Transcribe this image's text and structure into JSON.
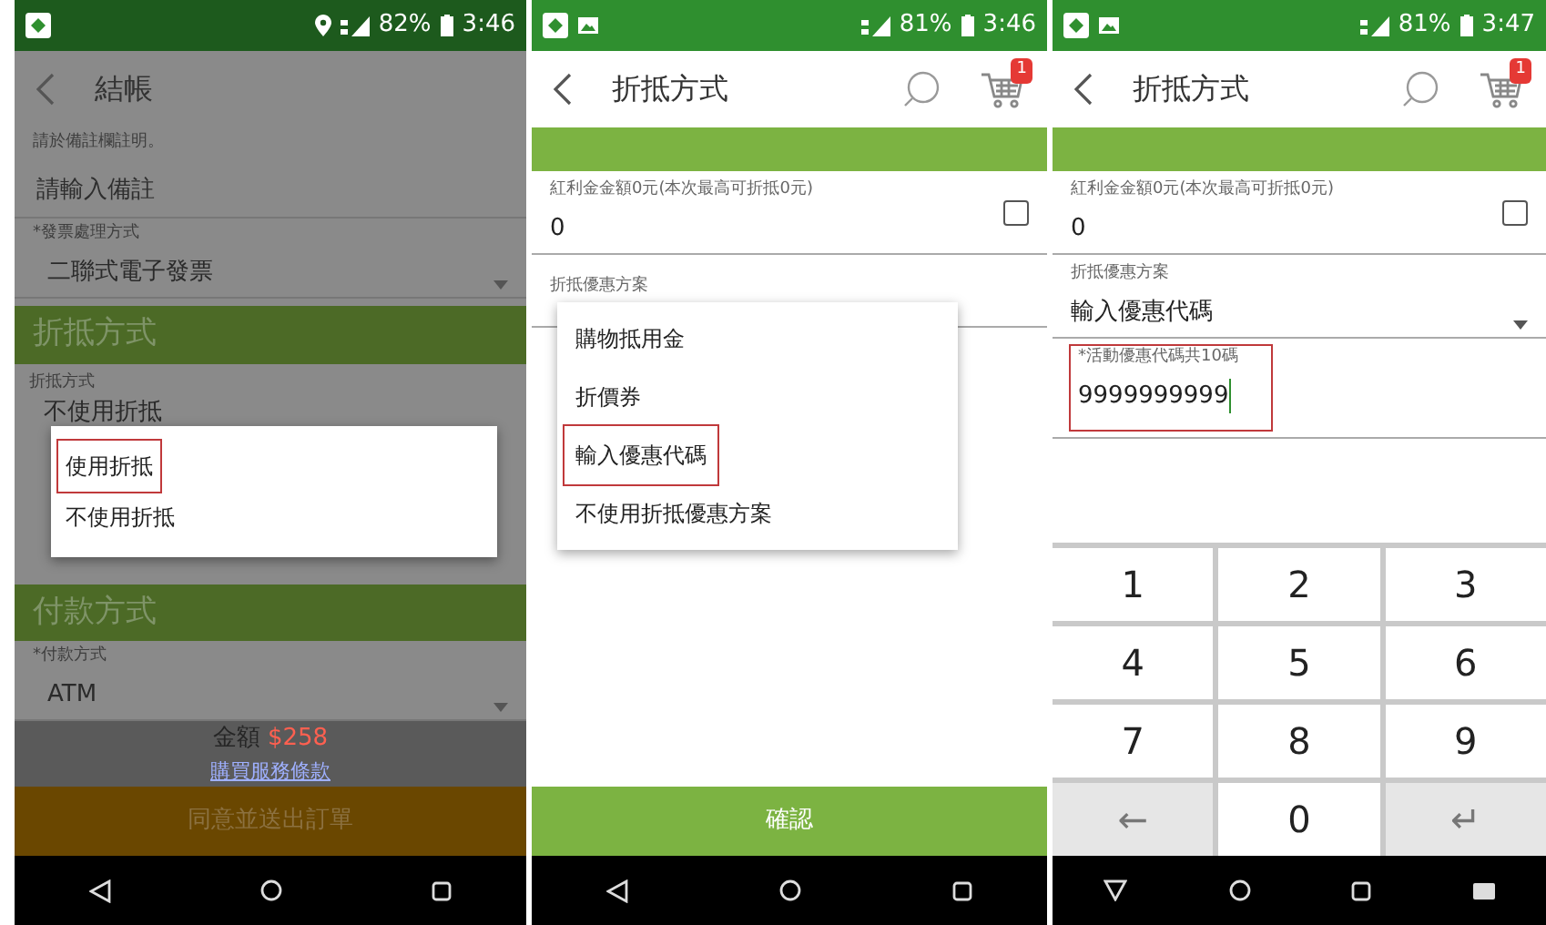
{
  "screens": [
    {
      "kind": "checkout",
      "status": {
        "location": true,
        "image_notice": false,
        "battery": "82%",
        "time": "3:46"
      },
      "title": "結帳",
      "remark_hint": "請於備註欄註明。",
      "remark": {
        "placeholder": "請輸入備註"
      },
      "invoice": {
        "label": "*發票處理方式",
        "value": "二聯式電子發票"
      },
      "discount_section": "折抵方式",
      "discount": {
        "label": "折抵方式",
        "value": "不使用折抵"
      },
      "dialog": [
        {
          "label": "使用折抵",
          "highlighted": true
        },
        {
          "label": "不使用折抵",
          "highlighted": false
        }
      ],
      "payment_section": "付款方式",
      "payment": {
        "label": "*付款方式",
        "value": "ATM"
      },
      "total_label": "金額",
      "total": "$258",
      "terms_link": "購買服務條款",
      "submit": "同意並送出訂單"
    },
    {
      "kind": "discount_menu",
      "status": {
        "location": false,
        "image_notice": true,
        "battery": "81%",
        "time": "3:46"
      },
      "title": "折抵方式",
      "cart_count": "1",
      "bonus": {
        "label": "紅利金金額0元(本次最高可折抵0元)",
        "value": "0",
        "checked": false
      },
      "plan": {
        "label": "折抵優惠方案"
      },
      "menu": [
        {
          "label": "購物抵用金",
          "highlighted": false
        },
        {
          "label": "折價券",
          "highlighted": false
        },
        {
          "label": "輸入優惠代碼",
          "highlighted": true
        },
        {
          "label": "不使用折抵優惠方案",
          "highlighted": false
        }
      ],
      "confirm": "確認"
    },
    {
      "kind": "code_entry",
      "status": {
        "location": false,
        "image_notice": true,
        "battery": "81%",
        "time": "3:47"
      },
      "title": "折抵方式",
      "cart_count": "1",
      "bonus": {
        "label": "紅利金金額0元(本次最高可折抵0元)",
        "value": "0",
        "checked": false
      },
      "plan": {
        "label": "折抵優惠方案",
        "value": "輸入優惠代碼"
      },
      "code": {
        "label": "*活動優惠代碼共10碼",
        "value": "9999999999",
        "highlighted": true
      },
      "keypad": [
        {
          "label": "1",
          "kind": "digit"
        },
        {
          "label": "2",
          "kind": "digit"
        },
        {
          "label": "3",
          "kind": "digit"
        },
        {
          "label": "4",
          "kind": "digit"
        },
        {
          "label": "5",
          "kind": "digit"
        },
        {
          "label": "6",
          "kind": "digit"
        },
        {
          "label": "7",
          "kind": "digit"
        },
        {
          "label": "8",
          "kind": "digit"
        },
        {
          "label": "9",
          "kind": "digit"
        },
        {
          "label": "←",
          "kind": "action"
        },
        {
          "label": "0",
          "kind": "digit"
        },
        {
          "label": "↵",
          "kind": "action"
        }
      ]
    }
  ]
}
